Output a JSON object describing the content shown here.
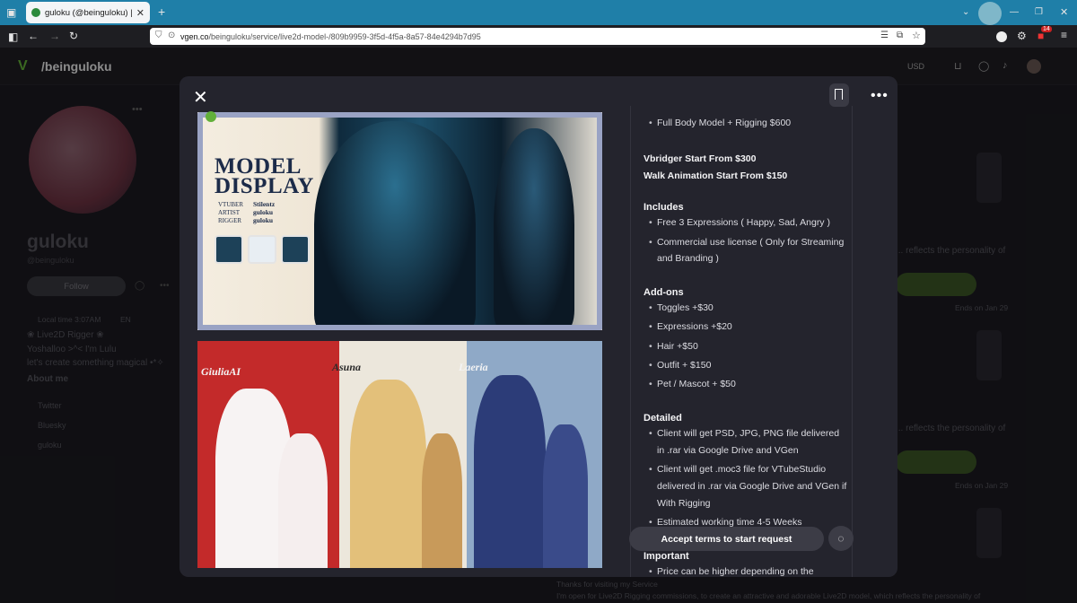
{
  "browser": {
    "tab_title": "guloku (@beinguloku) | VGen",
    "url_host": "vgen.co",
    "url_path": "/beinguloku/service/live2d-model-/809b9959-3f5d-4f5a-8a57-84e4294b7d95",
    "extension_badge": "14"
  },
  "site": {
    "handle": "/beinguloku",
    "currency": "USD"
  },
  "profile": {
    "name": "guloku",
    "username": "@beinguloku",
    "follow_label": "Follow",
    "local_time": "Local time 3:07AM",
    "language": "EN",
    "bio_line1": "❀ Live2D Rigger ❀",
    "bio_line2": "Yoshalloo >^< I'm Lulu",
    "bio_line3": "let's create something magical •*✧",
    "about_label": "About me",
    "links": [
      "Twitter",
      "Bluesky",
      "guloku"
    ]
  },
  "background_cards": {
    "snippet1": "... reflects the personality of",
    "ends1": "Ends on Jan 29",
    "snippet2": "... reflects the personality of",
    "ends2": "Ends on Jan 29",
    "bottom1": "Thanks for visiting my Service",
    "bottom2": "I'm open for Live2D Rigging commissions, to create an attractive and adorable Live2D model, which reflects the personality of"
  },
  "modal": {
    "image1": {
      "title_line1": "MODEL",
      "title_line2": "DISPLAY",
      "rows": [
        {
          "label": "VTUBER",
          "value": "Stilentz"
        },
        {
          "label": "ARTIST",
          "value": "guloku"
        },
        {
          "label": "RIGGER",
          "value": "guloku"
        }
      ]
    },
    "image2": {
      "names": [
        "GiuliaAI",
        "Asuna",
        "Laeria"
      ]
    },
    "content": {
      "pricing_item": "Full Body Model + Rigging  $600",
      "vbridger": "Vbridger Start From  $300",
      "walk": "Walk Animation Start From  $150",
      "includes_heading": "Includes",
      "includes": [
        "Free 3 Expressions ( Happy, Sad, Angry )",
        "Commercial use license ( Only for Streaming",
        "and Branding )"
      ],
      "addons_heading": "Add-ons",
      "addons": [
        "Toggles +$30",
        "Expressions +$20",
        "Hair +$50",
        "Outfit + $150",
        "Pet / Mascot + $50"
      ],
      "detailed_heading": "Detailed",
      "detailed": [
        "Client will get PSD, JPG, PNG file delivered",
        "in .rar via Google Drive and VGen",
        "Client will get .moc3 file for VTubeStudio",
        "delivered in .rar via Google Drive and VGen if",
        "With Rigging",
        "Estimated working time 4-5 Weeks"
      ],
      "important_heading": "Important",
      "important": [
        "Price can be higher depending on the"
      ]
    },
    "accept_label": "Accept terms to start request"
  }
}
